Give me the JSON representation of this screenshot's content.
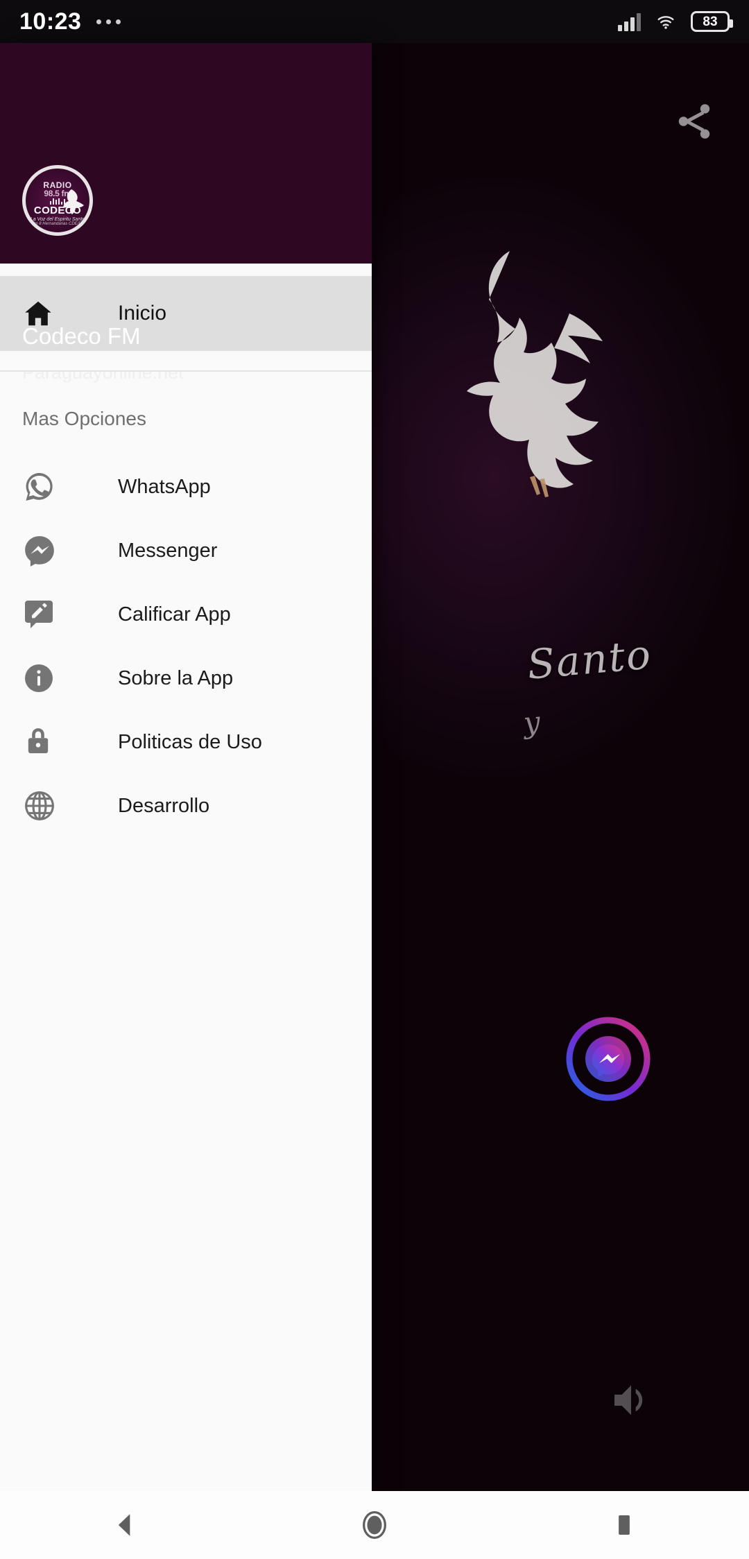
{
  "status_bar": {
    "time": "10:23",
    "notifications_icon": "more-notifications-icon",
    "signal_icon": "cellular-signal-icon",
    "wifi_icon": "wifi-icon",
    "battery_level": "83",
    "battery_icon": "battery-icon"
  },
  "drawer": {
    "header": {
      "avatar_icon": "radio-station-logo",
      "logo": {
        "line1": "RADIO",
        "line2": "98.5 fm",
        "line3": "CODECO",
        "tagline1": "La Voz del Espiritu Santo",
        "tagline2": "Km 8 Hernandarias CDE/Py"
      },
      "title": "Codeco FM",
      "subtitle": "Paraguayonline.net"
    },
    "selected_item": {
      "label": "Inicio",
      "icon": "home-icon"
    },
    "section_header": "Mas Opciones",
    "items": [
      {
        "label": "WhatsApp",
        "icon": "whatsapp-icon"
      },
      {
        "label": "Messenger",
        "icon": "messenger-icon"
      },
      {
        "label": "Calificar App",
        "icon": "rate-review-icon"
      },
      {
        "label": "Sobre la App",
        "icon": "info-icon"
      },
      {
        "label": "Politicas de Uso",
        "icon": "lock-icon"
      },
      {
        "label": "Desarrollo",
        "icon": "globe-icon"
      }
    ]
  },
  "background_app": {
    "share_icon": "share-icon",
    "volume_icon": "volume-up-icon",
    "messenger_bubble_icon": "messenger-chat-head-icon",
    "artwork_text_1": "Santo",
    "artwork_text_2": "y",
    "dove_icon": "dove-icon"
  },
  "navigation_bar": {
    "back": "back-nav-icon",
    "home": "home-nav-icon",
    "recents": "recents-nav-icon"
  },
  "colors": {
    "drawer_header_purple": "#2e0723",
    "drawer_background": "#fafafa",
    "selected_item_background": "#dedede",
    "icon_gray": "#757575",
    "status_bar_background": "#0d0b0e"
  }
}
